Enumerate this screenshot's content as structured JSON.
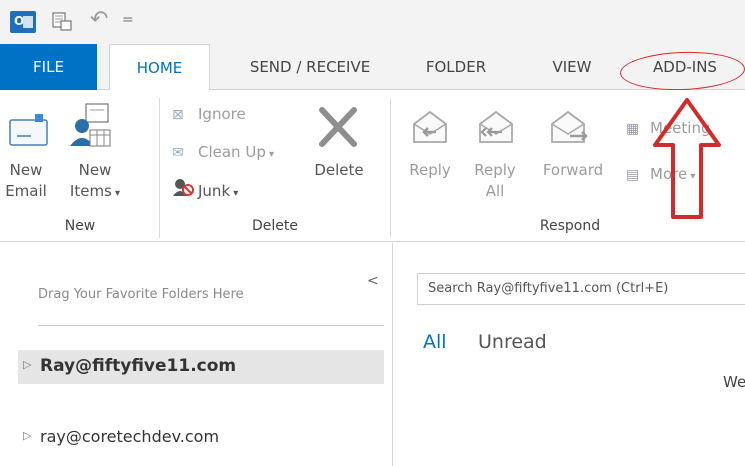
{
  "title_bar": {
    "outlook_logo_text": "O",
    "qat_more": "="
  },
  "tabs": [
    {
      "label": "FILE"
    },
    {
      "label": "HOME"
    },
    {
      "label": "SEND / RECEIVE"
    },
    {
      "label": "FOLDER"
    },
    {
      "label": "VIEW"
    },
    {
      "label": "ADD-INS"
    }
  ],
  "ribbon": {
    "new_group": {
      "new_email": [
        "New",
        "Email"
      ],
      "new_items": [
        "New",
        "Items"
      ],
      "label": "New"
    },
    "delete_group": {
      "ignore": "Ignore",
      "clean_up": "Clean Up",
      "junk": "Junk",
      "delete": "Delete",
      "label": "Delete"
    },
    "respond_group": {
      "reply": "Reply",
      "reply_all": [
        "Reply",
        "All"
      ],
      "forward": "Forward",
      "meeting": "Meeting",
      "more": "More",
      "label": "Respond"
    }
  },
  "folder_pane": {
    "drag_hint": "Drag Your Favorite Folders Here",
    "accounts": [
      {
        "name": "Ray@fiftyfive11.com",
        "selected": true
      },
      {
        "name": "ray@coretechdev.com",
        "selected": false
      }
    ]
  },
  "mail_pane": {
    "search_placeholder": "Search Ray@fiftyfive11.com (Ctrl+E)",
    "filter_all": "All",
    "filter_unread": "Unread",
    "partial_text": "We"
  },
  "colors": {
    "accent": "#0072c6",
    "annotation": "#d22b2b"
  },
  "annotations": {
    "ellipse_target": "add-ins-tab",
    "arrow_direction": "up"
  }
}
